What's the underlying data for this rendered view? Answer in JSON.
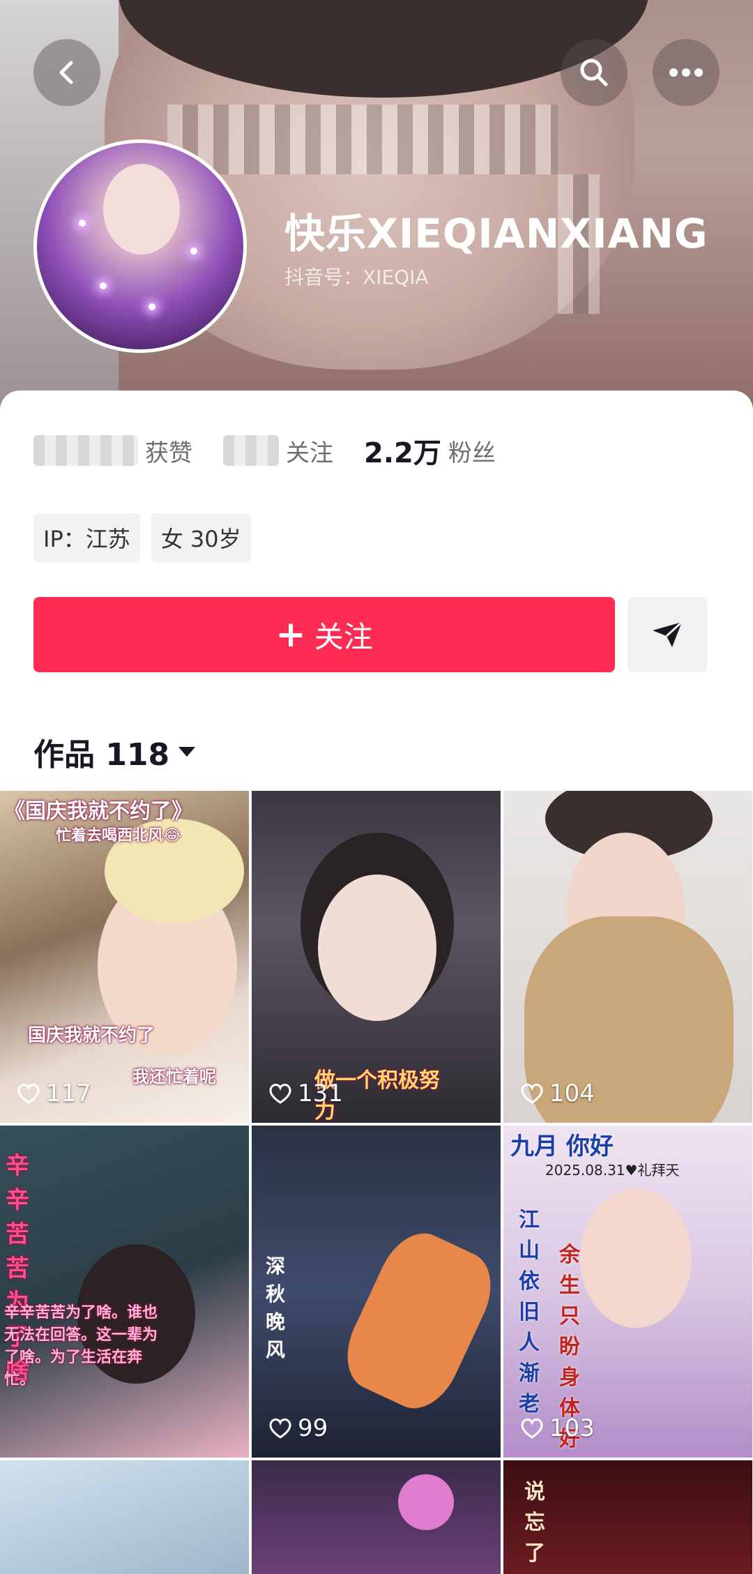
{
  "header": {
    "back_icon": "chevron-left-icon",
    "search_icon": "search-icon",
    "more_icon": "more-dots-icon",
    "nickname": "快乐XIEQIANXIANG",
    "handle": "抖音号：XIEQIA"
  },
  "stats": {
    "likes_label": "获赞",
    "following_label": "关注",
    "followers_value": "2.2万",
    "followers_label": "粉丝"
  },
  "tags": {
    "ip": "IP：江苏",
    "gender_age": "女 30岁"
  },
  "actions": {
    "follow_label": "关注",
    "follow_icon": "plus-icon",
    "share_icon": "paper-plane-icon"
  },
  "works": {
    "label": "作品 118",
    "dropdown_icon": "caret-down-icon"
  },
  "videos": [
    {
      "likes": "117",
      "caption_top": "《国庆我就不约了》",
      "caption_sub": "忙着去喝西北风😂",
      "caption_mid": "国庆我就不约了",
      "caption_low": "我还忙着呢"
    },
    {
      "likes": "131",
      "caption": "做一个积极努力"
    },
    {
      "likes": "104"
    },
    {
      "likes": "",
      "caption": "辛辛苦苦为了啥",
      "caption_small": "辛辛苦苦为了啥。谁也无法在回答。这一辈为了啥。为了生活在奔忙。"
    },
    {
      "likes": "99",
      "caption": "深秋晚风"
    },
    {
      "likes": "103",
      "caption_top": "九月 你好",
      "caption_date": "2025.08.31♥礼拜天",
      "caption_left": "江山依旧人渐老",
      "caption_right": "余生只盼身体好"
    },
    {
      "likes": ""
    },
    {
      "likes": ""
    },
    {
      "likes": "",
      "caption": "说忘了"
    }
  ],
  "colors": {
    "accent": "#fe2c55",
    "text": "#161823",
    "muted": "#6f6f73"
  }
}
